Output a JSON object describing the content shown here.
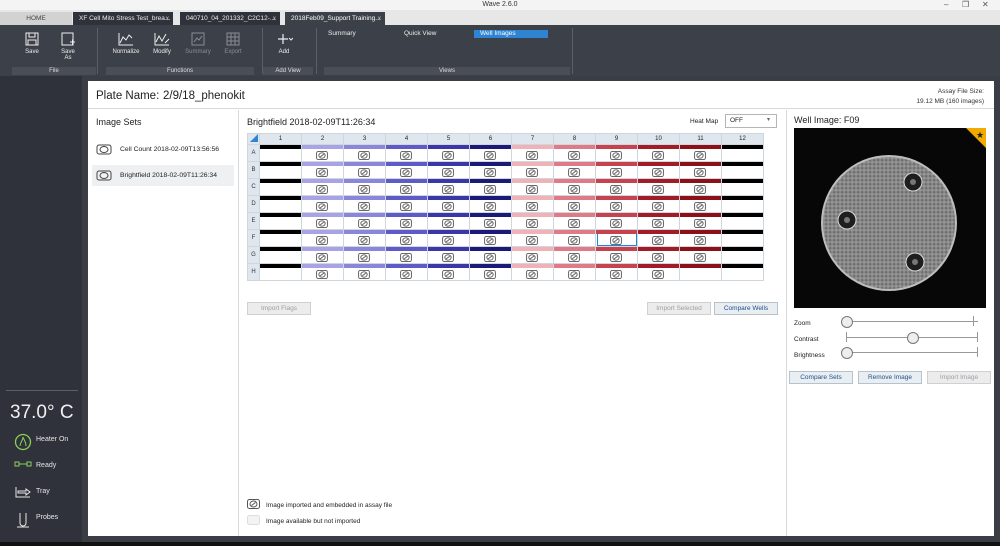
{
  "window": {
    "title": "Wave 2.6.0"
  },
  "tabs": [
    {
      "label": "HOME"
    },
    {
      "label": "XF Cell Mito Stress Test_brea...",
      "close": "x"
    },
    {
      "label": "040710_04_201332_C2C12-...",
      "close": "x"
    },
    {
      "label": "2018Feb09_Support Training...",
      "close": "x"
    }
  ],
  "ribbon": {
    "file": {
      "save": "Save",
      "save_as_line1": "Save",
      "save_as_line2": "As",
      "group": "File"
    },
    "functions": {
      "normalize": "Normalize",
      "modify": "Modify",
      "summary": "Summary",
      "export": "Export",
      "group": "Functions"
    },
    "add_view": {
      "add": "Add",
      "group": "Add View"
    },
    "views": {
      "summary": "Summary",
      "quick_view": "Quick View",
      "well_images": "Well Images",
      "group": "Views"
    }
  },
  "sidebar": {
    "temperature": "37.0° C",
    "heater": "Heater On",
    "ready": "Ready",
    "tray": "Tray",
    "probes": "Probes"
  },
  "plate": {
    "label": "Plate Name:",
    "name": "2/9/18_phenokit",
    "file_size_label": "Assay File Size:",
    "file_size_value": "19.12 MB  (160 images)"
  },
  "image_sets": {
    "title": "Image Sets",
    "items": [
      {
        "label": "Cell Count 2018-02-09T13:56:56"
      },
      {
        "label": "Brightfield 2018-02-09T11:26:34",
        "selected": true
      }
    ]
  },
  "grid_panel": {
    "title": "Brightfield 2018-02-09T11:26:34",
    "heatmap_label": "Heat Map",
    "heatmap_value": "OFF",
    "columns": [
      "1",
      "2",
      "3",
      "4",
      "5",
      "6",
      "7",
      "8",
      "9",
      "10",
      "11",
      "12"
    ],
    "rows": [
      "A",
      "B",
      "C",
      "D",
      "E",
      "F",
      "G",
      "H"
    ],
    "column_colors": [
      "#000000",
      "#a7a3e6",
      "#8a86dc",
      "#5e5ac8",
      "#3a37a8",
      "#1c1a78",
      "#f0b2b9",
      "#e07a86",
      "#c6424f",
      "#a21c27",
      "#8c1018",
      "#000000"
    ],
    "image_columns": [
      2,
      3,
      4,
      5,
      6,
      7,
      8,
      9,
      10,
      11
    ],
    "selected_well": "F09",
    "import_flags": "Import Flags",
    "import_selected": "Import Selected",
    "compare_wells": "Compare Wells"
  },
  "legend": {
    "imported": "Image imported and embedded in assay file",
    "available": "Image available but not imported"
  },
  "well_image": {
    "title": "Well Image: F09",
    "zoom": "Zoom",
    "contrast": "Contrast",
    "brightness": "Brightness",
    "zoom_level": 0,
    "contrast_level": 0.5,
    "brightness_level": 0,
    "compare_sets": "Compare Sets",
    "remove_image": "Remove Image",
    "import_image": "Import Image"
  }
}
